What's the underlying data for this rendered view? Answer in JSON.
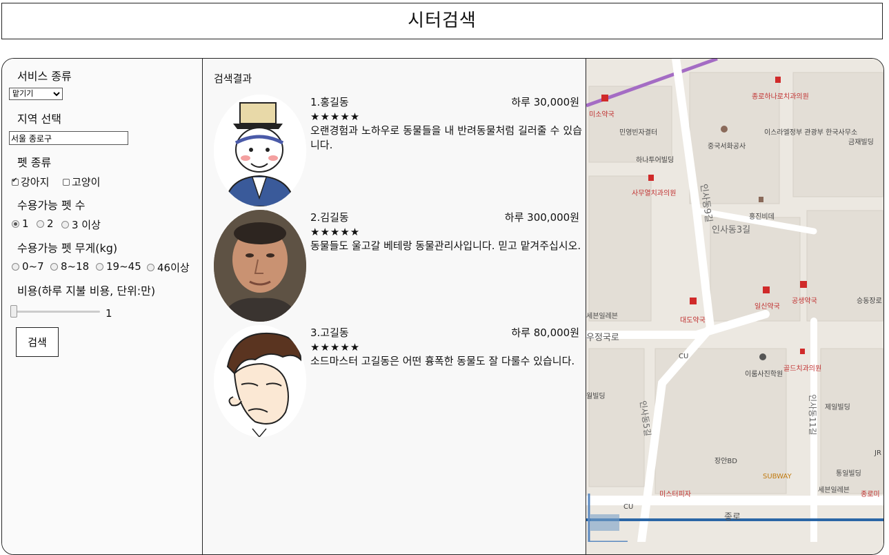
{
  "page": {
    "title": "시터검색"
  },
  "filters": {
    "service_label": "서비스 종류",
    "service_value": "맡기기",
    "region_label": "지역 선택",
    "region_value": "서울 종로구",
    "pet_type_label": "펫 종류",
    "pet_types": [
      {
        "label": "강아지",
        "checked": true
      },
      {
        "label": "고양이",
        "checked": false
      }
    ],
    "pet_count_label": "수용가능 펫 수",
    "pet_counts": [
      {
        "label": "1",
        "selected": true
      },
      {
        "label": "2",
        "selected": false
      },
      {
        "label": "3 이상",
        "selected": false
      }
    ],
    "pet_weight_label": "수용가능 펫 무게(kg)",
    "pet_weights": [
      {
        "label": "0~7",
        "selected": false
      },
      {
        "label": "8~18",
        "selected": false
      },
      {
        "label": "19~45",
        "selected": false
      },
      {
        "label": "46이상",
        "selected": false
      }
    ],
    "cost_label": "비용(하루 지불 비용, 단위:만)",
    "cost_value": "1",
    "search_button": "검색"
  },
  "results": {
    "heading": "검색결과",
    "items": [
      {
        "name": "1.홍길동",
        "price": "하루 30,000원",
        "stars": "★★★★★",
        "desc": "오랜경험과 노하우로 동물들을 내 반려동물처럼 길러줄 수 있습니다."
      },
      {
        "name": "2.김길동",
        "price": "하루 300,000원",
        "stars": "★★★★★",
        "desc": "동물들도 울고갈 베테랑 동물관리사입니다. 믿고 맡겨주십시오."
      },
      {
        "name": "3.고길동",
        "price": "하루 80,000원",
        "stars": "★★★★★",
        "desc": "소드마스터 고길동은 어떤 흉폭한 동물도 잘 다룰수 있습니다."
      }
    ]
  },
  "map": {
    "labels": [
      "종로하나로치과의원",
      "미소약국",
      "민영빈자결터",
      "중국서화공사",
      "이스라엘정부 관광부 한국사무소",
      "금재빌딩",
      "하나투어빌딩",
      "사무열치과의원",
      "인사동3길",
      "인사동9길",
      "홍진비데",
      "일신약국",
      "공생약국",
      "승동장로",
      "대도약국",
      "CU",
      "이룸사진학원",
      "골드치과의원",
      "세븐일레븐",
      "우정국로",
      "월빌딩",
      "제일빌딩",
      "인사동11길",
      "장안BD",
      "SUBWAY",
      "통일빌딩",
      "미스터피자",
      "CU",
      "세븐일레븐",
      "종로미",
      "종로",
      "JR",
      "인사동5길"
    ]
  }
}
